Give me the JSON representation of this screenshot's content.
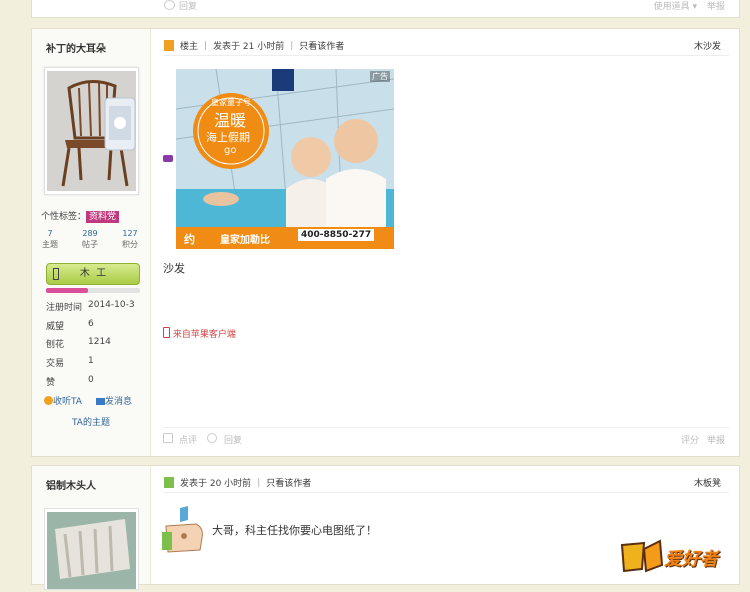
{
  "top_post_actions": {
    "reply": "回复",
    "tools": "使用道具 ▾",
    "report": "举报"
  },
  "post1": {
    "author": "补丁的大耳朵",
    "tag_label": "个性标签：",
    "tag_value": "资料党",
    "stats": [
      {
        "value": "7",
        "label": "主题"
      },
      {
        "value": "289",
        "label": "帖子"
      },
      {
        "value": "127",
        "label": "积分"
      }
    ],
    "rank": "木  工",
    "rank_progress": 0.45,
    "info": [
      {
        "k": "注册时间",
        "v": "2014-10-3"
      },
      {
        "k": "威望",
        "v": "6"
      },
      {
        "k": "刨花",
        "v": "1214"
      },
      {
        "k": "交易",
        "v": "1"
      },
      {
        "k": "赞",
        "v": "0"
      }
    ],
    "follow": "收听TA",
    "message": "发消息",
    "topics": "TA的主题",
    "floor_badge": "楼主",
    "time": "发表于 21 小时前",
    "only_author": "只看该作者",
    "floor_name": "木沙发",
    "ad": {
      "tag": "广告",
      "brand_small": "皇家量子号",
      "headline1": "温暖",
      "headline2": "海上假期",
      "go": "go",
      "cta_pre": "约",
      "cta_mid": "皇家加勒比",
      "phone": "400-8850-277"
    },
    "body": "沙发",
    "source": "来自苹果客户端",
    "rate": "点评",
    "reply": "回复",
    "score": "评分",
    "report": "举报"
  },
  "post2": {
    "author": "铝制木头人",
    "time": "发表于 20 小时前",
    "only_author": "只看该作者",
    "floor_name": "木板凳",
    "body": "大哥，科主任找你要心电图纸了！"
  },
  "watermark": "爱好者"
}
